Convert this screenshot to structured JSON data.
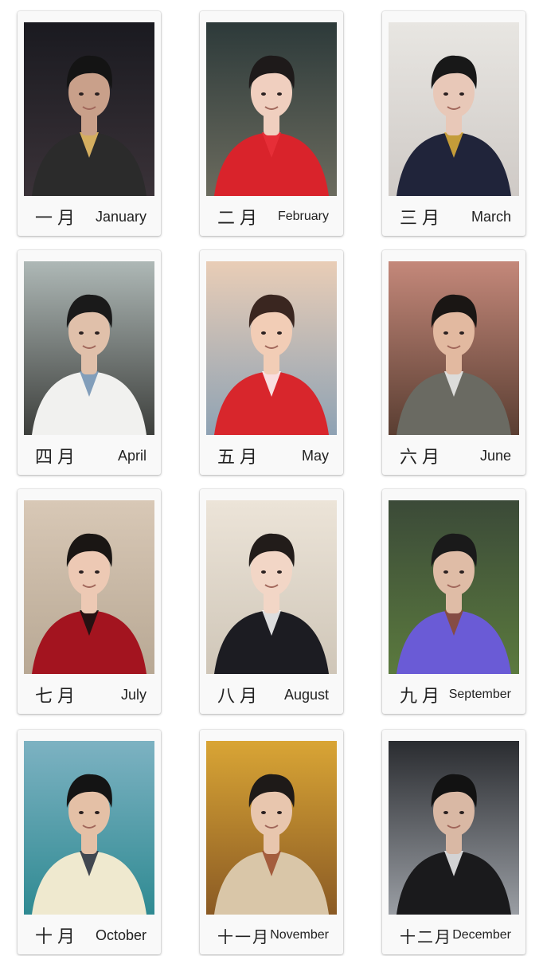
{
  "cards": [
    {
      "cn": "一月",
      "en": "January",
      "scene": {
        "bg": "#1a1a20",
        "bg2": "#3a3238",
        "top": "#2b2b2b",
        "skin": "#c9a08a",
        "hair": "#141414",
        "accent": "#f2c66a"
      }
    },
    {
      "cn": "二月",
      "en": "February",
      "scene": {
        "bg": "#2d3a3a",
        "bg2": "#6b6b5e",
        "top": "#d9232b",
        "skin": "#f0cfbf",
        "hair": "#1e1a1a",
        "accent": "#e8303a"
      }
    },
    {
      "cn": "三月",
      "en": "March",
      "scene": {
        "bg": "#e8e6e2",
        "bg2": "#cfcac6",
        "top": "#20243a",
        "skin": "#e8c8b8",
        "hair": "#181818",
        "accent": "#e2b23a"
      }
    },
    {
      "cn": "四月",
      "en": "April",
      "scene": {
        "bg": "#aeb8b6",
        "bg2": "#3d3f3c",
        "top": "#f1f1ef",
        "skin": "#e0c0aa",
        "hair": "#1a1a1a",
        "accent": "#6f8fb0"
      }
    },
    {
      "cn": "五月",
      "en": "May",
      "scene": {
        "bg": "#e9cdb6",
        "bg2": "#8ea2b4",
        "top": "#d8262c",
        "skin": "#f2cdb6",
        "hair": "#3a2620",
        "accent": "#ffffff"
      }
    },
    {
      "cn": "六月",
      "en": "June",
      "scene": {
        "bg": "#c4887a",
        "bg2": "#5a3e32",
        "top": "#6a6a62",
        "skin": "#e2b9a0",
        "hair": "#1a1614",
        "accent": "#f0f0f0"
      }
    },
    {
      "cn": "七月",
      "en": "July",
      "scene": {
        "bg": "#d8c8b6",
        "bg2": "#b8a894",
        "top": "#a3141f",
        "skin": "#edc9b4",
        "hair": "#1a1614",
        "accent": "#111111"
      }
    },
    {
      "cn": "八月",
      "en": "August",
      "scene": {
        "bg": "#ece4d8",
        "bg2": "#cfc6b8",
        "top": "#1c1c22",
        "skin": "#f2d6c6",
        "hair": "#221c1a",
        "accent": "#ffffff"
      }
    },
    {
      "cn": "九月",
      "en": "September",
      "scene": {
        "bg": "#3b4a38",
        "bg2": "#5b7a3e",
        "top": "#6a5bd6",
        "skin": "#dfbca6",
        "hair": "#1a1a1a",
        "accent": "#8a4a2a"
      }
    },
    {
      "cn": "十月",
      "en": "October",
      "scene": {
        "bg": "#7db2c2",
        "bg2": "#2f8a92",
        "top": "#efe9cf",
        "skin": "#e4c0a6",
        "hair": "#141414",
        "accent": "#222a3a"
      }
    },
    {
      "cn": "十一月",
      "en": "November",
      "scene": {
        "bg": "#d9a535",
        "bg2": "#8a5a24",
        "top": "#d9c6a8",
        "skin": "#e8c6ae",
        "hair": "#1e1a18",
        "accent": "#9a4a2a"
      }
    },
    {
      "cn": "十二月",
      "en": "December",
      "scene": {
        "bg": "#2a2c30",
        "bg2": "#9a9ea4",
        "top": "#1a1a1c",
        "skin": "#d9b8a4",
        "hair": "#121212",
        "accent": "#f4f4f4"
      }
    }
  ]
}
